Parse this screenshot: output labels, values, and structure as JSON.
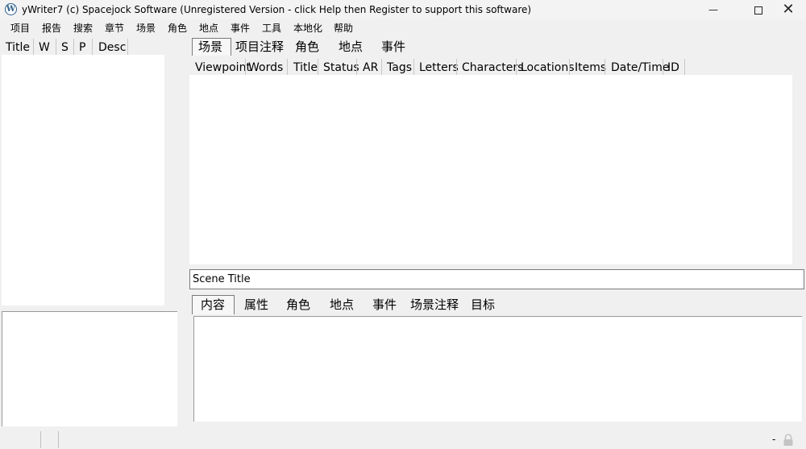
{
  "window": {
    "title": "yWriter7 (c) Spacejock Software (Unregistered Version - click Help then Register to support this software)",
    "icon": "ywriter-logo-icon",
    "minimize": "—",
    "close": "✕"
  },
  "menu": [
    "项目",
    "报告",
    "搜索",
    "章节",
    "场景",
    "角色",
    "地点",
    "事件",
    "工具",
    "本地化",
    "帮助"
  ],
  "chapter_list": {
    "columns": [
      "Title",
      "W",
      "S",
      "P",
      "Desc"
    ]
  },
  "top_tabs": [
    "场景",
    "项目注释",
    "角色",
    "地点",
    "事件"
  ],
  "scene_list": {
    "columns": [
      "Viewpoint",
      "Words",
      "Title",
      "Status",
      "AR",
      "Tags",
      "Letters",
      "Characters",
      "Locations",
      "Items",
      "Date/Time",
      "ID"
    ]
  },
  "scene_title": {
    "value": "Scene Title"
  },
  "bottom_tabs": [
    "内容",
    "属性",
    "角色",
    "地点",
    "事件",
    "场景注释",
    "目标"
  ],
  "statusbar": {
    "dash": "-",
    "lock_icon": "lock-icon"
  }
}
